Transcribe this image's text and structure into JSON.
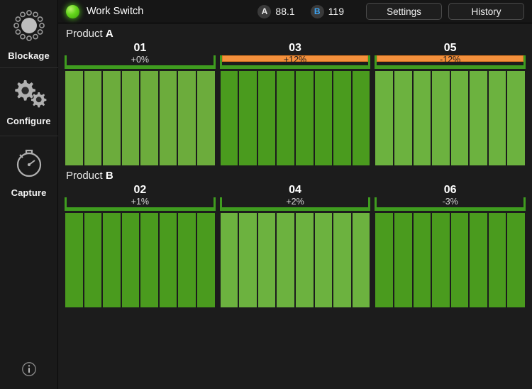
{
  "sidebar": {
    "items": [
      {
        "label": "Blockage",
        "icon": "blockage-ring-icon"
      },
      {
        "label": "Configure",
        "icon": "gears-icon"
      },
      {
        "label": "Capture",
        "icon": "stopwatch-icon"
      }
    ],
    "info_icon": "info-icon"
  },
  "header": {
    "status_icon": "status-led-green",
    "title": "Work Switch",
    "channels": [
      {
        "badge": "A",
        "value": "88.1",
        "badge_color": "#e8e8e8"
      },
      {
        "badge": "B",
        "value": "119",
        "badge_color": "#3da5f5"
      }
    ],
    "buttons": [
      {
        "label": "Settings"
      },
      {
        "label": "History"
      }
    ]
  },
  "colors": {
    "alert": "#f4903c",
    "bracket_green": "#3f9c1f",
    "background": "#1c1c1c",
    "sidebar": "#1a1a1a"
  },
  "chart_data": {
    "type": "bar",
    "title": "Blockage monitor rows",
    "products": [
      {
        "name": "Product",
        "letter": "A",
        "sections": [
          {
            "number": "01",
            "delta": "+0%",
            "alert": false,
            "bar_color": "#6cac3c",
            "values": [
              100,
              100,
              100,
              100,
              100,
              100,
              100,
              100
            ]
          },
          {
            "number": "03",
            "delta": "+12%",
            "alert": true,
            "bar_color": "#4a9b1e",
            "values": [
              100,
              100,
              100,
              100,
              100,
              100,
              100,
              100
            ]
          },
          {
            "number": "05",
            "delta": "-12%",
            "alert": true,
            "bar_color": "#6cb23f",
            "values": [
              100,
              100,
              100,
              100,
              100,
              100,
              100,
              100
            ]
          }
        ]
      },
      {
        "name": "Product",
        "letter": "B",
        "sections": [
          {
            "number": "02",
            "delta": "+1%",
            "alert": false,
            "bar_color": "#4a9b1e",
            "values": [
              100,
              100,
              100,
              100,
              100,
              100,
              100,
              100
            ]
          },
          {
            "number": "04",
            "delta": "+2%",
            "alert": false,
            "bar_color": "#6cb23f",
            "values": [
              100,
              100,
              100,
              100,
              100,
              100,
              100,
              100
            ]
          },
          {
            "number": "06",
            "delta": "-3%",
            "alert": false,
            "bar_color": "#4a9b1e",
            "values": [
              100,
              100,
              100,
              100,
              100,
              100,
              100,
              100
            ]
          }
        ]
      }
    ],
    "bars_per_section": 8,
    "ylim": [
      0,
      100
    ],
    "xlabel": "",
    "ylabel": ""
  }
}
